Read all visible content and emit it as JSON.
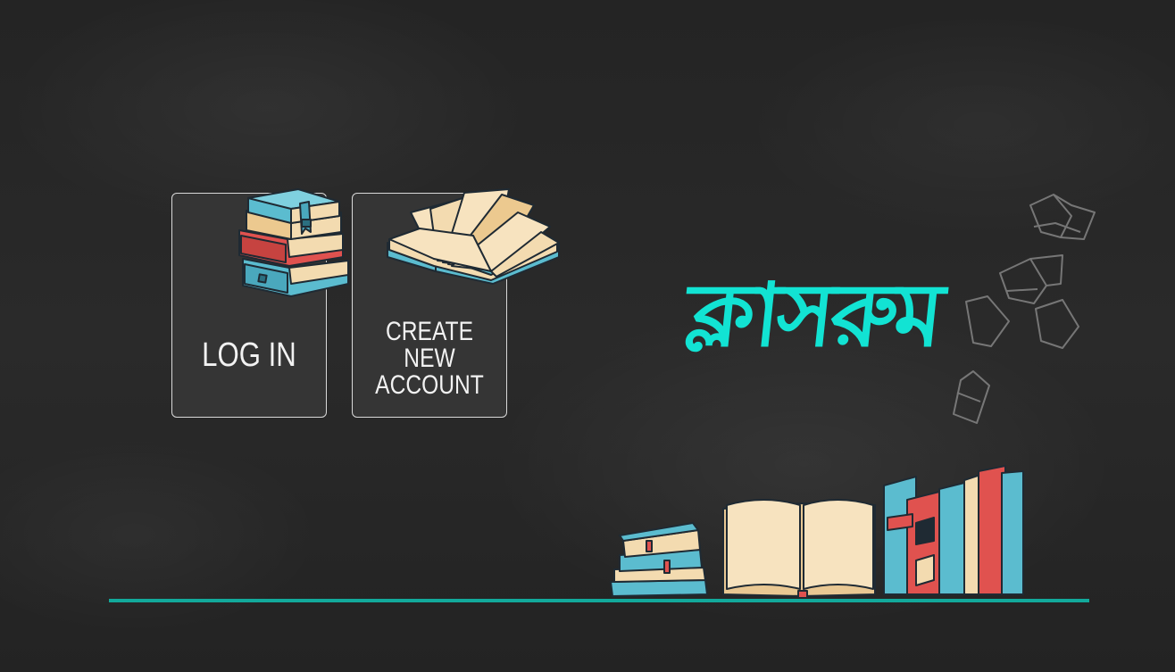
{
  "auth": {
    "login_label": "LOG IN",
    "create_label_lines": [
      "CREATE",
      "NEW",
      "ACCOUNT"
    ]
  },
  "brand": {
    "logo_text": "ক্লাসরুম",
    "logo_color": "#12e3d3"
  },
  "colors": {
    "background": "#262626",
    "card_bg": "#353535",
    "card_border": "#d9d9d9",
    "shelf_line": "#12a99b",
    "book_blue": "#5bbccf",
    "book_red": "#e0524f",
    "book_cream": "#f3dbb0"
  },
  "icons": {
    "login_card": "book-stack-icon",
    "create_card": "open-book-icon",
    "decoration_top": "flying-books-icon",
    "decoration_bottom": "bookshelf-icon"
  }
}
